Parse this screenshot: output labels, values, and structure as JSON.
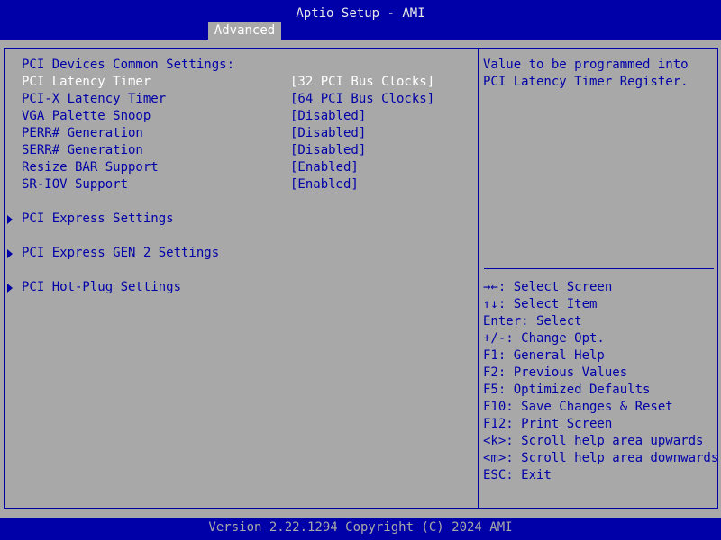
{
  "header": {
    "title": "Aptio Setup - AMI",
    "tab_label": "Advanced"
  },
  "settings": {
    "section_heading": "PCI Devices Common Settings:",
    "items": [
      {
        "label": "PCI Latency Timer",
        "value": "[32 PCI Bus Clocks]",
        "selected": true
      },
      {
        "label": "PCI-X Latency Timer",
        "value": "[64 PCI Bus Clocks]",
        "selected": false
      },
      {
        "label": "VGA Palette Snoop",
        "value": "[Disabled]",
        "selected": false
      },
      {
        "label": "PERR# Generation",
        "value": "[Disabled]",
        "selected": false
      },
      {
        "label": "SERR# Generation",
        "value": "[Disabled]",
        "selected": false
      },
      {
        "label": "Resize BAR Support",
        "value": "[Enabled]",
        "selected": false
      },
      {
        "label": "SR-IOV Support",
        "value": "[Enabled]",
        "selected": false
      }
    ],
    "submenus": [
      {
        "label": "PCI Express Settings"
      },
      {
        "label": "PCI Express GEN 2 Settings"
      },
      {
        "label": "PCI Hot-Plug Settings"
      }
    ]
  },
  "help": {
    "lines": [
      "Value to be programmed into",
      "PCI Latency Timer Register."
    ],
    "keys": [
      "→←: Select Screen",
      "↑↓: Select Item",
      "Enter: Select",
      "+/-: Change Opt.",
      "F1: General Help",
      "F2: Previous Values",
      "F5: Optimized Defaults",
      "F10: Save Changes & Reset",
      "F12: Print Screen",
      "<k>: Scroll help area upwards",
      "<m>: Scroll help area downwards",
      "ESC: Exit"
    ]
  },
  "footer": {
    "text": "Version 2.22.1294 Copyright (C) 2024 AMI"
  },
  "colors": {
    "background_blue": "#0000a8",
    "panel_gray": "#a8a8a8",
    "selected_text": "#ffffff"
  }
}
